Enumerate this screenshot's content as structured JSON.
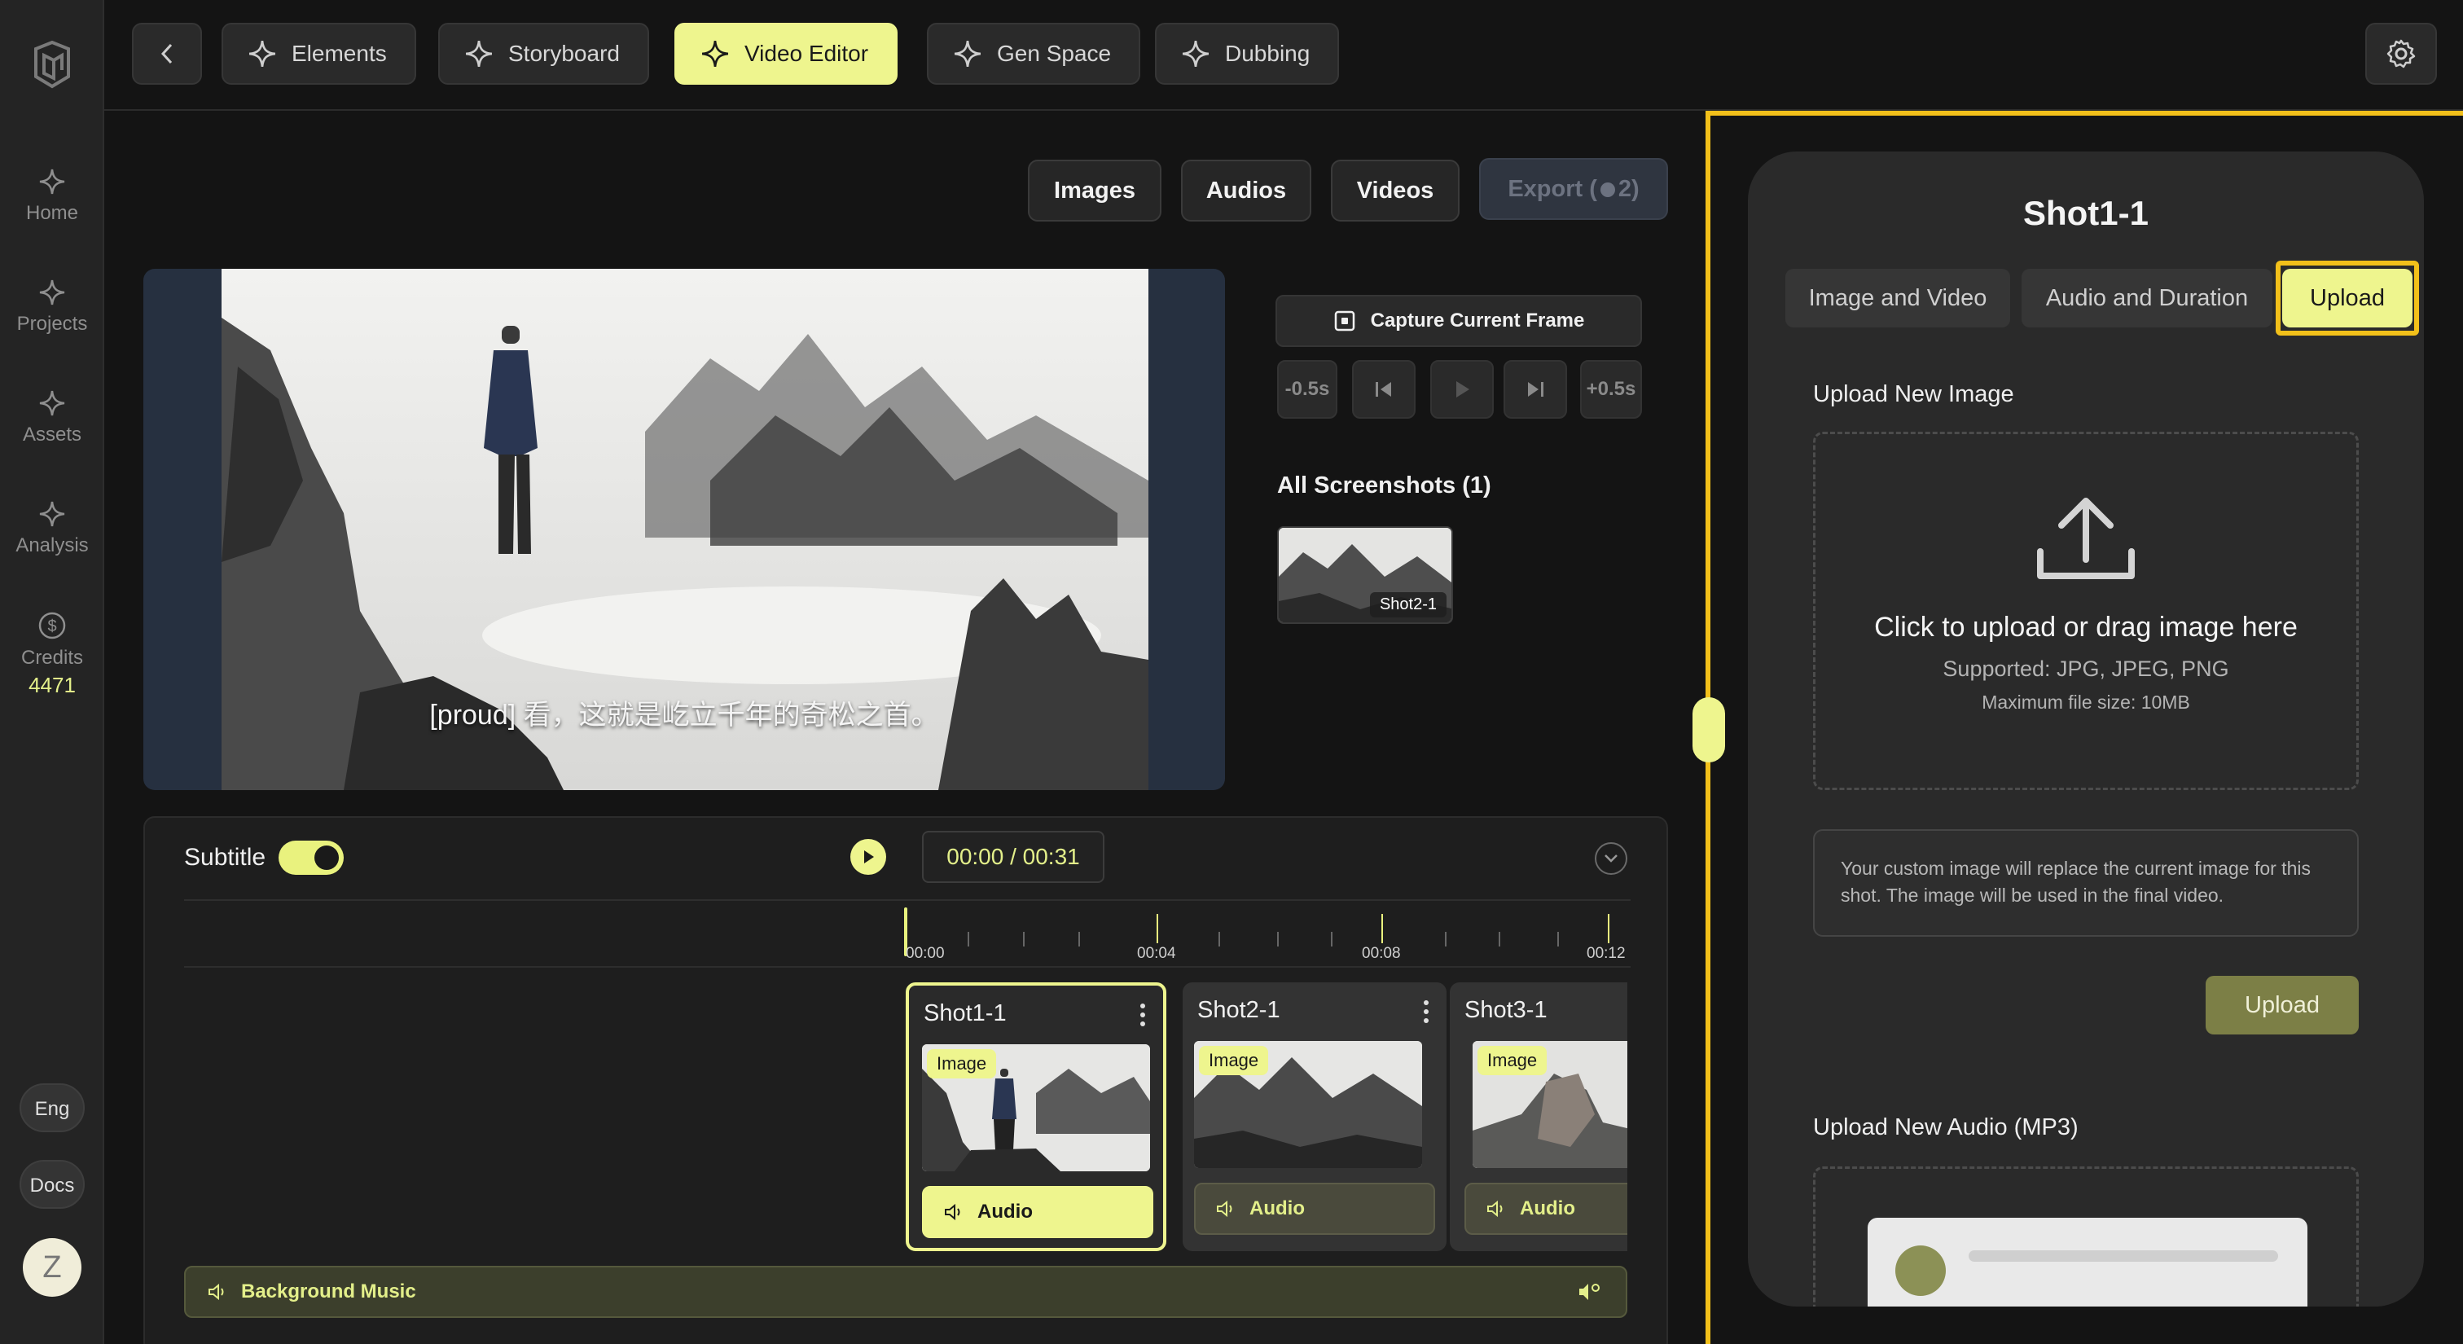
{
  "rail": {
    "items": [
      {
        "label": "Home",
        "icon": "star4-icon"
      },
      {
        "label": "Projects",
        "icon": "star4-icon"
      },
      {
        "label": "Assets",
        "icon": "star4-icon"
      },
      {
        "label": "Analysis",
        "icon": "star4-icon"
      },
      {
        "label": "Credits",
        "icon": "dollar-icon"
      }
    ],
    "credits_value": "4471",
    "lang": "Eng",
    "docs": "Docs",
    "avatar_letter": "Z"
  },
  "topbar": {
    "tabs": [
      {
        "label": "Elements"
      },
      {
        "label": "Storyboard"
      },
      {
        "label": "Video Editor"
      },
      {
        "label": "Gen Space"
      },
      {
        "label": "Dubbing"
      }
    ],
    "active_tab": "Video Editor"
  },
  "media": {
    "images": "Images",
    "audios": "Audios",
    "videos": "Videos",
    "export": "Export (",
    "export_count": "2)"
  },
  "preview": {
    "subtitle": "[proud] 看，这就是屹立千年的奇松之首。"
  },
  "capture": {
    "label": "Capture Current Frame",
    "back": "-0.5s",
    "forward": "+0.5s"
  },
  "screenshots": {
    "title": "All Screenshots (1)",
    "items": [
      {
        "tag": "Shot2-1"
      }
    ]
  },
  "timeline": {
    "subtitle_label": "Subtitle",
    "time": "00:00 / 00:31",
    "ticks": [
      "00:00",
      "00:04",
      "00:08",
      "00:12"
    ],
    "clips": [
      {
        "name": "Shot1-1",
        "badge": "Image",
        "audio": "Audio"
      },
      {
        "name": "Shot2-1",
        "badge": "Image",
        "audio": "Audio"
      },
      {
        "name": "Shot3-1",
        "badge": "Image",
        "audio": "Audio"
      }
    ],
    "bgm": "Background Music"
  },
  "panel": {
    "title": "Shot1-1",
    "tabs": [
      "Image and Video",
      "Audio and Duration",
      "Upload"
    ],
    "active_tab": "Upload",
    "upload_image_label": "Upload New Image",
    "drop_heading": "Click to upload or drag image here",
    "drop_supported": "Supported: JPG, JPEG, PNG",
    "drop_max": "Maximum file size: 10MB",
    "note": "Your custom image will replace the current image for this shot. The image will be used in the final video.",
    "upload_button": "Upload",
    "upload_audio_label": "Upload New Audio (MP3)"
  },
  "colors": {
    "accent": "#eef58e",
    "highlight": "#f2c01a",
    "background": "#141414"
  }
}
